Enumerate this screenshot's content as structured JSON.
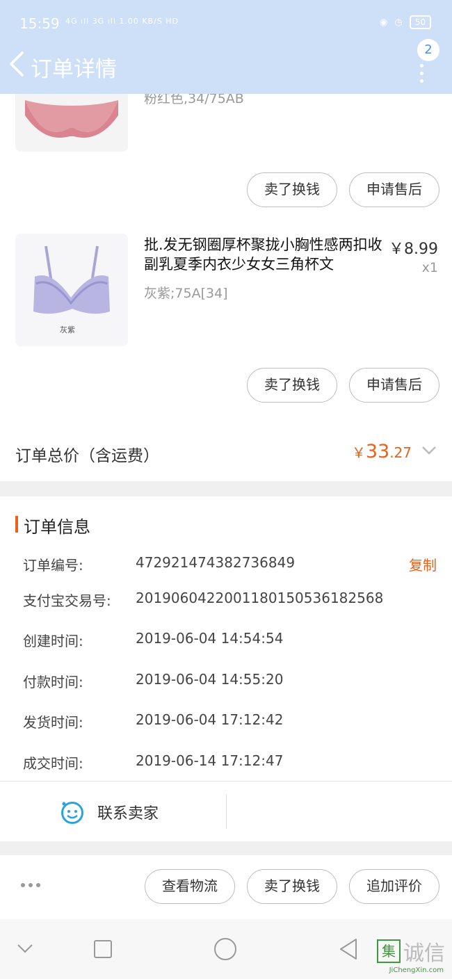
{
  "status_bar": {
    "time": "15:59",
    "signal": "4G ıll 3G ıll 1.00 KB/S HD",
    "battery": "50"
  },
  "nav": {
    "title": "订单详情",
    "badge_count": "2"
  },
  "items": [
    {
      "variant": "粉红色,34/75AB",
      "buttons": [
        "卖了换钱",
        "申请售后"
      ]
    },
    {
      "title": "批.发无钢圈厚杯聚拢小胸性感两扣收副乳夏季内衣少女女三角杯文",
      "price": "￥8.99",
      "qty": "x1",
      "variant": "灰紫;75A[34]",
      "thumb_caption": "灰紫",
      "buttons": [
        "卖了换钱",
        "申请售后"
      ]
    }
  ],
  "total": {
    "label": "订单总价（含运费）",
    "currency": "￥",
    "integer": "33",
    "decimal": ".27"
  },
  "order_info": {
    "title": "订单信息",
    "copy_label": "复制",
    "rows": [
      {
        "label": "订单编号:",
        "value": "472921474382736849"
      },
      {
        "label": "支付宝交易号:",
        "value": "2019060422001180150536182568"
      },
      {
        "label": "创建时间:",
        "value": "2019-06-04 14:54:54"
      },
      {
        "label": "付款时间:",
        "value": "2019-06-04 14:55:20"
      },
      {
        "label": "发货时间:",
        "value": "2019-06-04 17:12:42"
      },
      {
        "label": "成交时间:",
        "value": "2019-06-14 17:12:47"
      }
    ]
  },
  "contact": {
    "label": "联系卖家"
  },
  "bottom_actions": [
    "查看物流",
    "卖了换钱",
    "追加评价"
  ],
  "watermark": {
    "mark": "集",
    "text": "诚信",
    "url": "JiChengXin.com"
  },
  "colors": {
    "header_bg": "#cde0f7",
    "accent": "#e8621a",
    "brand_icon": "#2aa3e0"
  }
}
